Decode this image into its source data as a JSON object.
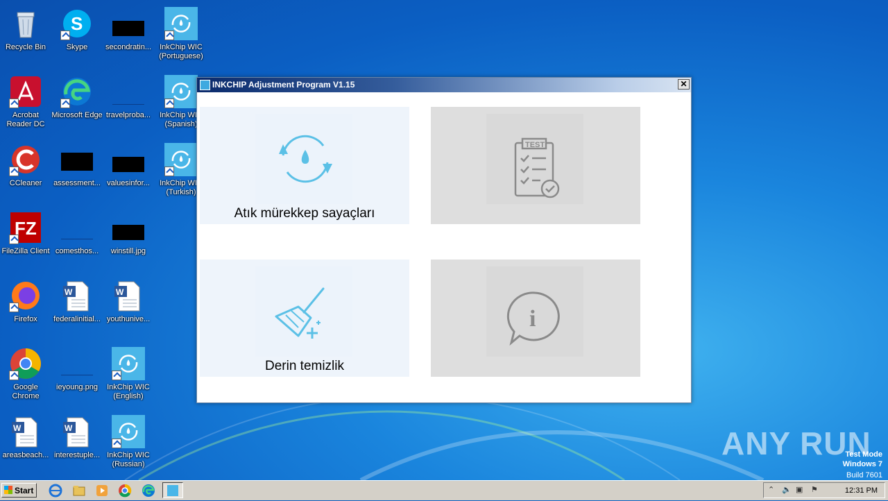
{
  "desktop": {
    "icons": [
      {
        "label": "Recycle Bin"
      },
      {
        "label": "Skype"
      },
      {
        "label": "secondratin..."
      },
      {
        "label": "InkChip WIC (Portuguese)"
      },
      {
        "label": "Acrobat Reader DC"
      },
      {
        "label": "Microsoft Edge"
      },
      {
        "label": "travelproba..."
      },
      {
        "label": "InkChip WIC (Spanish)"
      },
      {
        "label": "CCleaner"
      },
      {
        "label": "assessment..."
      },
      {
        "label": "valuesinfor..."
      },
      {
        "label": "InkChip WIC (Turkish)"
      },
      {
        "label": "FileZilla Client"
      },
      {
        "label": "comesthos..."
      },
      {
        "label": "winstill.jpg"
      },
      {
        "label": "Firefox"
      },
      {
        "label": "federalinitial..."
      },
      {
        "label": "youthunive..."
      },
      {
        "label": "Google Chrome"
      },
      {
        "label": "ieyoung.png"
      },
      {
        "label": "InkChip WIC (English)"
      },
      {
        "label": "areasbeach..."
      },
      {
        "label": "interestuple..."
      },
      {
        "label": "InkChip WIC (Russian)"
      }
    ]
  },
  "window": {
    "title": "INKCHIP Adjustment Program V1.15",
    "close_label": "✕",
    "tiles": [
      {
        "label": "Atık mürekkep sayaçları",
        "icon": "refresh-ink-icon"
      },
      {
        "label": "",
        "icon": "test-checklist-icon",
        "badge": "TEST"
      },
      {
        "label": "Derin temizlik",
        "icon": "broom-icon"
      },
      {
        "label": "",
        "icon": "info-bubble-icon",
        "glyph": "i"
      }
    ]
  },
  "taskbar": {
    "start_label": "Start",
    "clock": "12:31 PM"
  },
  "watermark": {
    "line1": "Test Mode",
    "line2": "Windows 7",
    "line3": "Build 7601",
    "brand": "ANY RUN"
  }
}
